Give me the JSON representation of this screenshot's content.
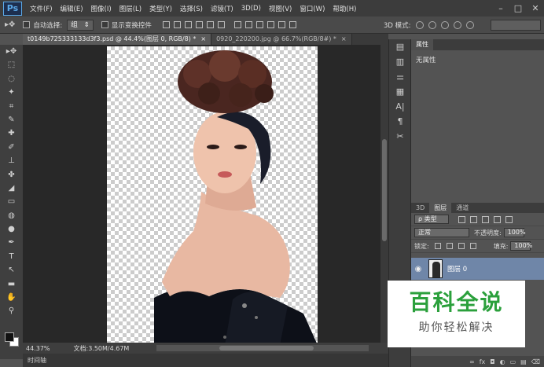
{
  "app": {
    "logo": "Ps"
  },
  "menu": [
    "文件(F)",
    "编辑(E)",
    "图像(I)",
    "图层(L)",
    "类型(Y)",
    "选择(S)",
    "滤镜(T)",
    "3D(D)",
    "视图(V)",
    "窗口(W)",
    "帮助(H)"
  ],
  "window_controls": [
    "–",
    "□",
    "✕"
  ],
  "options": {
    "auto_select_label": "自动选择:",
    "auto_select_value": "组",
    "show_transform_label": "显示变换控件",
    "mode3d_label": "3D 模式:"
  },
  "tabs": [
    {
      "label": "t0149b725333133d3f3.psd @ 44.4%(图层 0, RGB/8) *",
      "close": "×"
    },
    {
      "label": "0920_220200.jpg @ 66.7%(RGB/8#) *",
      "close": "×"
    }
  ],
  "tools": [
    "▸✥",
    "⬚",
    "◌",
    "✦",
    "⌗",
    "✎",
    "✚",
    "✐",
    "⊥",
    "✤",
    "◢",
    "▭",
    "◍",
    "●",
    "✒",
    "T",
    "↖",
    "▬",
    "✋",
    "⚲"
  ],
  "status": {
    "zoom": "44.37%",
    "doc_info": "文档:3.50M/4.67M",
    "timeline": "时间轴"
  },
  "icon_strip": [
    "▤",
    "▥",
    "⚌",
    "▦",
    "A|",
    "¶",
    "✂"
  ],
  "properties": {
    "tab": "属性",
    "body": "无属性"
  },
  "layers": {
    "tabs": [
      "3D",
      "图层",
      "通道"
    ],
    "filter_label": "ρ 类型",
    "blend_mode": "正常",
    "opacity_label": "不透明度:",
    "opacity_value": "100%",
    "lock_label": "锁定:",
    "fill_label": "填充:",
    "fill_value": "100%",
    "layer_name": "图层 0",
    "footer_icons": [
      "∞",
      "fx",
      "◘",
      "◐",
      "▭",
      "▤",
      "⌫"
    ]
  },
  "watermark": {
    "title": "百科全说",
    "subtitle": "助你轻松解决"
  }
}
